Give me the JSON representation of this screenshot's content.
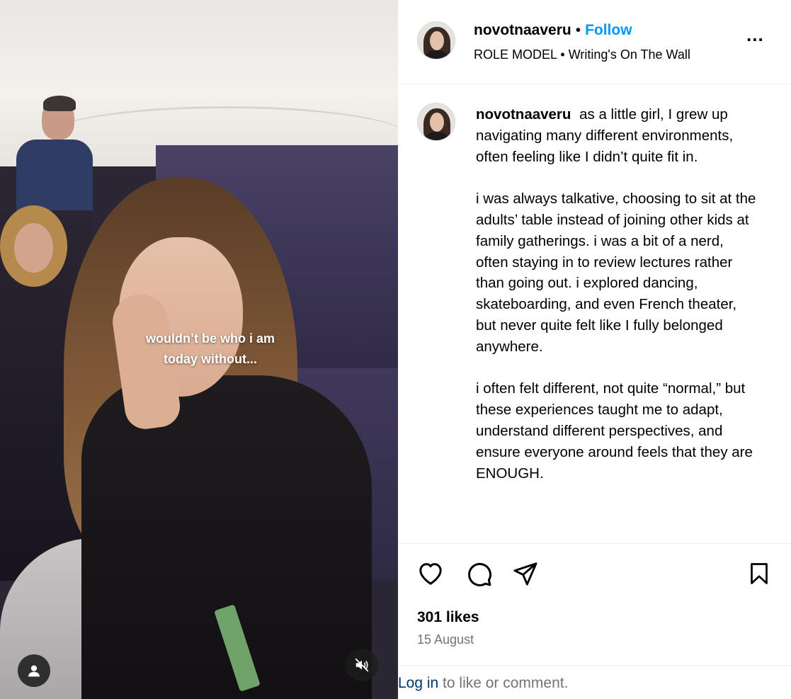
{
  "media": {
    "overlay_line1": "wouldn’t be who i am",
    "overlay_line2": "today without...",
    "tag_icon": "user-tag-icon",
    "mute_icon": "speaker-muted-icon"
  },
  "header": {
    "username": "novotnaaveru",
    "separator": "•",
    "follow_label": "Follow",
    "audio_artist": "ROLE MODEL",
    "audio_separator": "•",
    "audio_track": "Writing's On The Wall",
    "more_label": "..."
  },
  "caption": {
    "username": "novotnaaveru",
    "paragraphs": [
      "as a little girl, I grew up navigating many different environments, often feeling like I didn’t quite fit in.",
      "i was always talkative, choosing to sit at the adults’ table instead of joining other kids at family gatherings. i was a bit of a nerd, often staying in to review lectures rather than going out. i explored dancing, skateboarding, and even French theater, but never quite felt like I fully belonged anywhere.",
      "i often felt different, not quite “normal,” but these experiences taught me to adapt, understand different perspectives, and ensure everyone around feels that they are ENOUGH."
    ]
  },
  "actions": {
    "icons": [
      "heart-icon",
      "comment-icon",
      "share-icon",
      "bookmark-icon"
    ],
    "likes": "301 likes",
    "date": "15 August"
  },
  "login": {
    "link_label": "Log in",
    "rest": " to like or comment."
  },
  "colors": {
    "accent": "#0095f6",
    "secondary_text": "#737373",
    "link": "#00376b",
    "divider": "#efefef"
  }
}
